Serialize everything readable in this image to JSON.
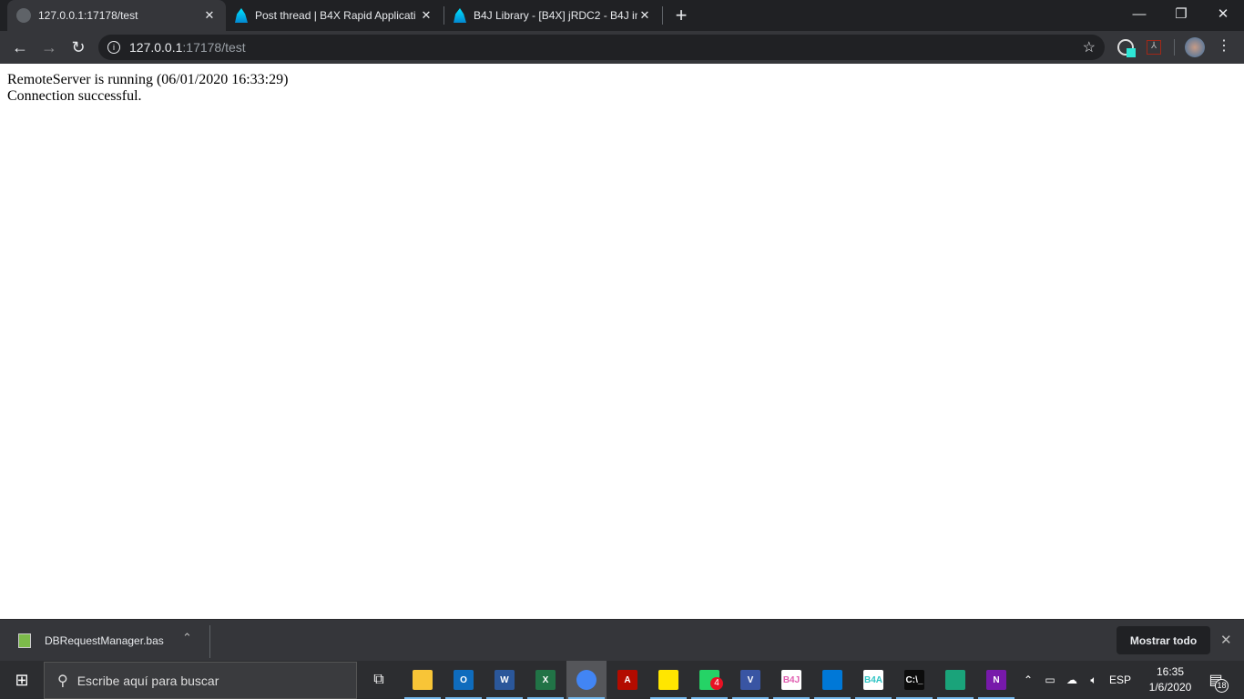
{
  "browser": {
    "tabs": [
      {
        "title": "127.0.0.1:17178/test",
        "active": true
      },
      {
        "title": "Post thread | B4X Rapid Applicati",
        "active": false
      },
      {
        "title": "B4J Library - [B4X] jRDC2 - B4J in",
        "active": false
      }
    ],
    "new_tab": "+",
    "url_host": "127.0.0.1",
    "url_rest": ":17178/test"
  },
  "page": {
    "line1": "RemoteServer is running (06/01/2020 16:33:29)",
    "line2": "Connection successful."
  },
  "downloads": {
    "file": "DBRequestManager.bas",
    "show_all": "Mostrar todo"
  },
  "taskbar": {
    "search_placeholder": "Escribe aquí para buscar",
    "apps": [
      {
        "name": "file-explorer",
        "label": "",
        "color": "#f8c537"
      },
      {
        "name": "outlook",
        "label": "O",
        "color": "#0f6cbd"
      },
      {
        "name": "word",
        "label": "W",
        "color": "#2b579a"
      },
      {
        "name": "excel",
        "label": "X",
        "color": "#217346"
      },
      {
        "name": "chrome",
        "label": "",
        "color": "#4285f4"
      },
      {
        "name": "acrobat",
        "label": "A",
        "color": "#b30b00"
      },
      {
        "name": "sticky-notes",
        "label": "",
        "color": "#ffe600"
      },
      {
        "name": "whatsapp",
        "label": "",
        "color": "#25d366"
      },
      {
        "name": "visio",
        "label": "V",
        "color": "#3955a3"
      },
      {
        "name": "b4j",
        "label": "B4J",
        "color": "#ffffff"
      },
      {
        "name": "b4x-editor",
        "label": "",
        "color": "#0078d7"
      },
      {
        "name": "b4a",
        "label": "B4A",
        "color": "#ffffff"
      },
      {
        "name": "terminal",
        "label": "C:\\_",
        "color": "#0c0c0c"
      },
      {
        "name": "app-green",
        "label": "",
        "color": "#1aa37a"
      },
      {
        "name": "onenote",
        "label": "N",
        "color": "#7719aa"
      }
    ],
    "whatsapp_badge": "4",
    "language": "ESP",
    "time": "16:35",
    "date": "1/6/2020",
    "notifications": "18"
  }
}
